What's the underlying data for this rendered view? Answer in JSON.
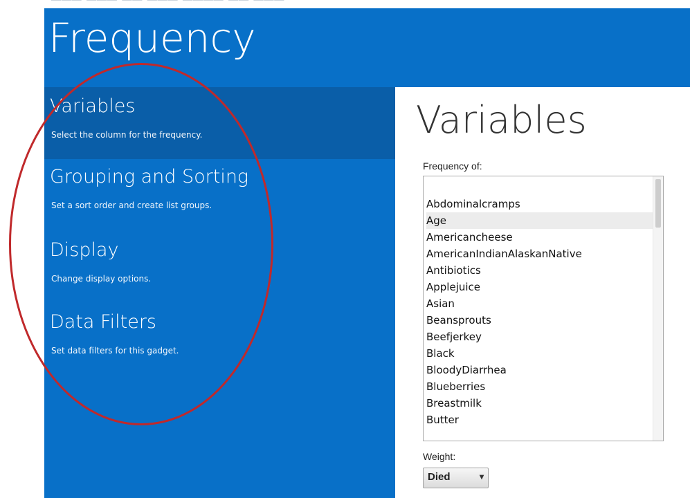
{
  "header": {
    "title": "Frequency"
  },
  "sidebar": {
    "items": [
      {
        "title": "Variables",
        "description": "Select the column for the frequency."
      },
      {
        "title": "Grouping and Sorting",
        "description": "Set a sort order and create list groups."
      },
      {
        "title": "Display",
        "description": "Change display options."
      },
      {
        "title": "Data Filters",
        "description": "Set data filters for this gadget."
      }
    ]
  },
  "content": {
    "title": "Variables",
    "frequency_label": "Frequency of:",
    "variables": [
      "Abdominalcramps",
      "Age",
      "Americancheese",
      "AmericanIndianAlaskanNative",
      "Antibiotics",
      "Applejuice",
      "Asian",
      "Beansprouts",
      "Beefjerkey",
      "Black",
      "BloodyDiarrhea",
      "Blueberries",
      "Breastmilk",
      "Butter"
    ],
    "highlighted_variable": "Age",
    "weight_label": "Weight:",
    "weight_value": "Died",
    "weight_arrow_icon": "chevron-down-icon"
  },
  "colors": {
    "header_blue": "#0870c8",
    "selected_blue": "#0a5ea8",
    "annotation_red": "#c0292b"
  }
}
